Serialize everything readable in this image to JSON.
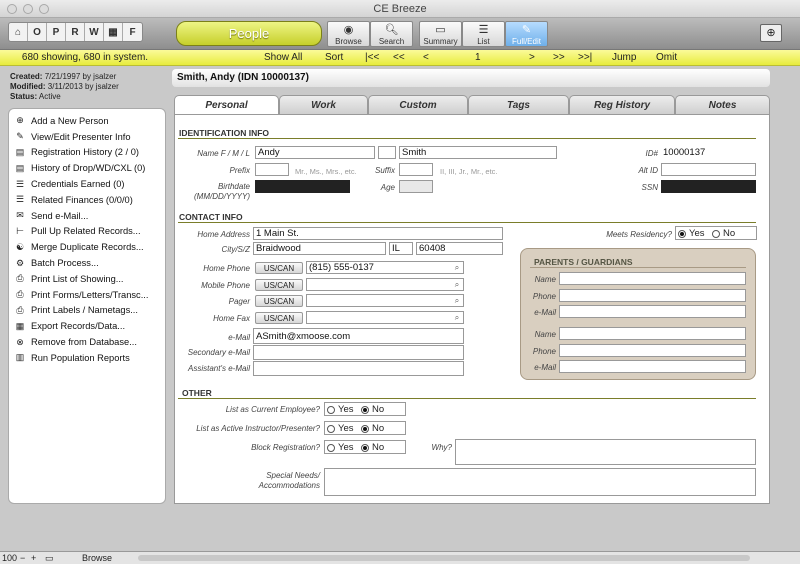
{
  "window": {
    "title": "CE Breeze"
  },
  "toolbar": {
    "nav_letters": [
      "O",
      "P",
      "R",
      "W",
      "▦",
      "F"
    ],
    "module_label": "People",
    "buttons": [
      {
        "label": "Browse",
        "icon": "eye-icon"
      },
      {
        "label": "Search",
        "icon": "magnifier-icon"
      },
      {
        "label": "Summary",
        "icon": "summary-icon"
      },
      {
        "label": "List",
        "icon": "list-icon"
      },
      {
        "label": "Full/Edit",
        "icon": "edit-icon"
      }
    ]
  },
  "status": {
    "count_text": "680 showing, 680 in system.",
    "show_all": "Show All",
    "sort": "Sort",
    "first": "|<<",
    "prev_jump": "<<",
    "prev": "<",
    "record_number": "1",
    "next": ">",
    "next_jump": ">>",
    "last": ">>|",
    "jump": "Jump",
    "omit": "Omit"
  },
  "meta": {
    "created_label": "Created:",
    "created_value": "7/21/1997 by jsalzer",
    "modified_label": "Modified:",
    "modified_value": "3/11/2013 by jsalzer",
    "status_label": "Status:",
    "status_value": "Active"
  },
  "sidebar": {
    "items": [
      {
        "label": "Add a New Person",
        "icon": "plus-circle-icon"
      },
      {
        "label": "View/Edit Presenter Info",
        "icon": "pencil-icon"
      },
      {
        "label": "Registration History (2 / 0)",
        "icon": "clipboard-icon"
      },
      {
        "label": "History of Drop/WD/CXL (0)",
        "icon": "clipboard-icon"
      },
      {
        "label": "Credentials Earned (0)",
        "icon": "list-icon"
      },
      {
        "label": "Related Finances (0/0/0)",
        "icon": "list-icon"
      },
      {
        "label": "Send e-Mail...",
        "icon": "envelope-icon"
      },
      {
        "label": "Pull Up Related Records...",
        "icon": "tree-icon"
      },
      {
        "label": "Merge Duplicate Records...",
        "icon": "merge-icon"
      },
      {
        "label": "Batch Process...",
        "icon": "batch-icon"
      },
      {
        "label": "Print List of Showing...",
        "icon": "printer-icon"
      },
      {
        "label": "Print Forms/Letters/Transc...",
        "icon": "printer-icon"
      },
      {
        "label": "Print Labels / Nametags...",
        "icon": "printer-icon"
      },
      {
        "label": "Export Records/Data...",
        "icon": "export-icon"
      },
      {
        "label": "Remove from Database...",
        "icon": "remove-circle-icon"
      },
      {
        "label": "Run Population Reports",
        "icon": "bar-chart-icon"
      }
    ]
  },
  "record": {
    "header": "Smith, Andy  (IDN 10000137)"
  },
  "tabs": [
    "Personal",
    "Work",
    "Custom",
    "Tags",
    "Reg History",
    "Notes"
  ],
  "identification": {
    "section_title": "IDENTIFICATION INFO",
    "name_label": "Name F / M / L",
    "first": "Andy",
    "middle": "",
    "last": "Smith",
    "id_label": "ID#",
    "id_value": "10000137",
    "prefix_label": "Prefix",
    "prefix_hint": "Mr., Ms., Mrs., etc.",
    "suffix_label": "Suffix",
    "suffix_hint": "II, III, Jr., Mr., etc.",
    "altid_label": "Alt ID",
    "birthdate_label": "Birthdate (MM/DD/YYYY)",
    "age_label": "Age",
    "ssn_label": "SSN"
  },
  "contact": {
    "section_title": "CONTACT INFO",
    "home_address_label": "Home Address",
    "home_address": "1 Main St.",
    "csz_label": "City/S/Z",
    "city": "Braidwood",
    "state": "IL",
    "zip": "60408",
    "residency_label": "Meets Residency?",
    "residency_yes": "Yes",
    "residency_no": "No",
    "country_button": "US/CAN",
    "home_phone_label": "Home Phone",
    "home_phone": "(815) 555-0137",
    "mobile_phone_label": "Mobile Phone",
    "pager_label": "Pager",
    "home_fax_label": "Home Fax",
    "email_label": "e-Mail",
    "email": "ASmith@xmoose.com",
    "secondary_email_label": "Secondary e-Mail",
    "assistant_email_label": "Assistant's e-Mail"
  },
  "guardians": {
    "title": "PARENTS / GUARDIANS",
    "name_label": "Name",
    "phone_label": "Phone",
    "email_label": "e-Mail"
  },
  "other": {
    "section_title": "OTHER",
    "employee_label": "List as Current Employee?",
    "instructor_label": "List as Active Instructor/Presenter?",
    "block_label": "Block Registration?",
    "why_label": "Why?",
    "special_label": "Special Needs/ Accommodations",
    "yes": "Yes",
    "no": "No"
  },
  "bottom": {
    "zoom": "100",
    "mode": "Browse"
  }
}
